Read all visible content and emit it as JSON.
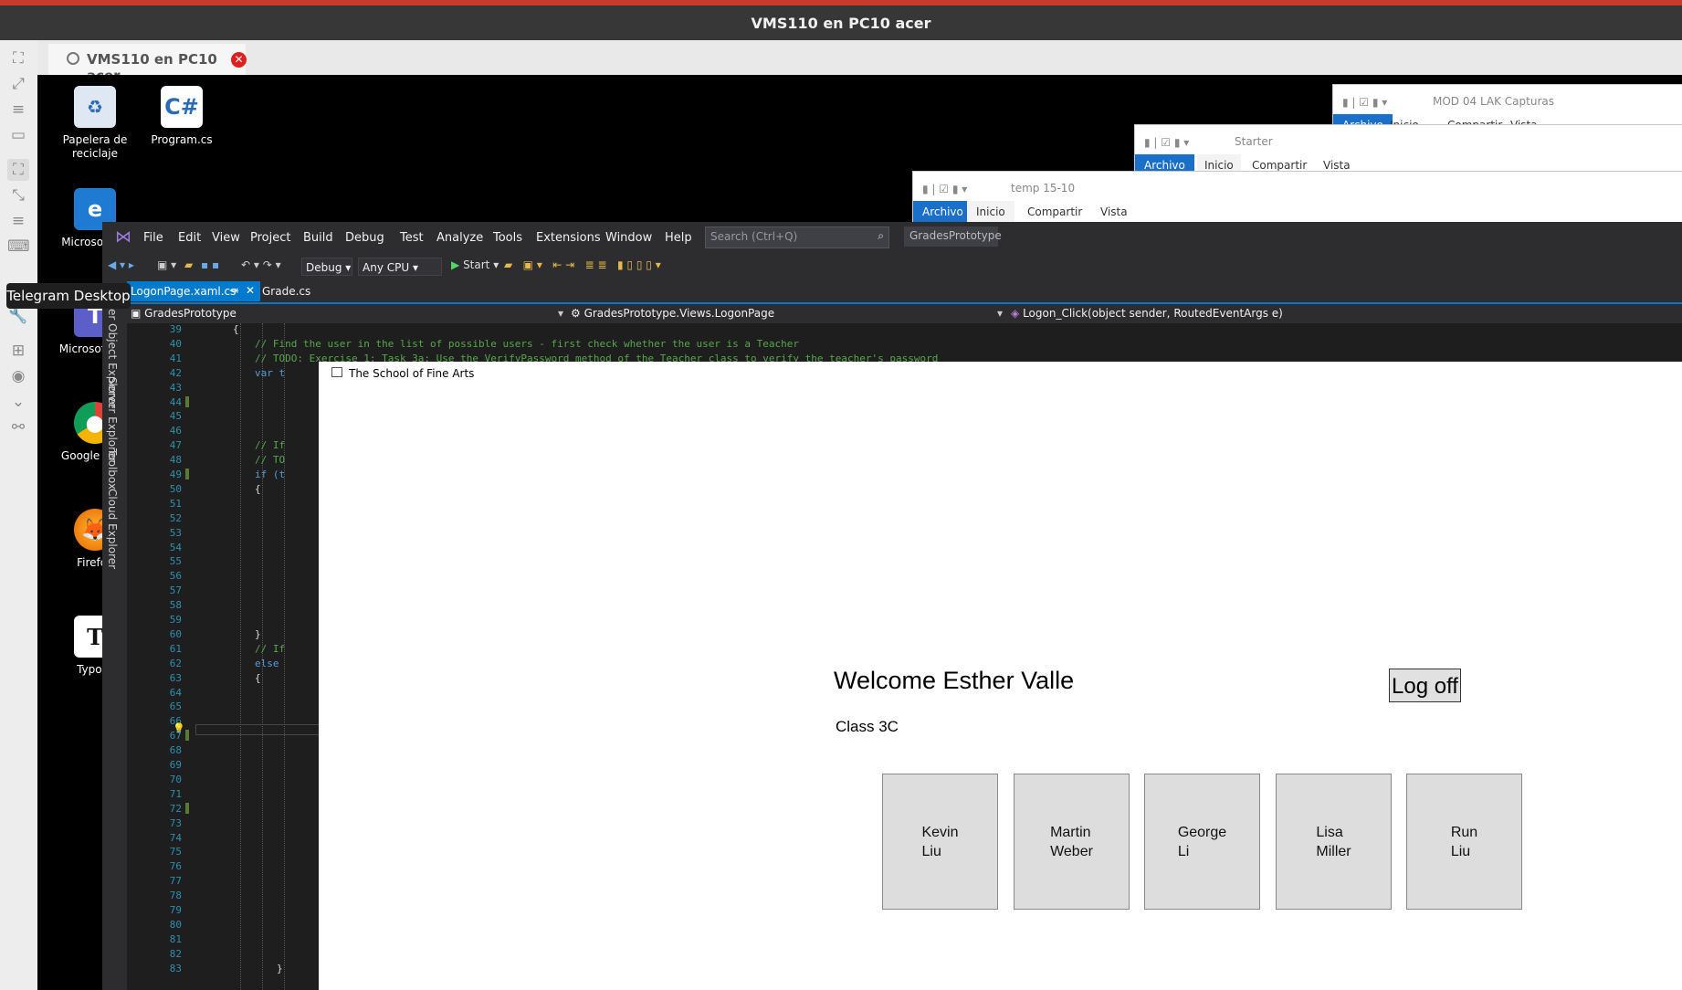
{
  "host": {
    "window_title": "VMS110 en PC10 acer",
    "tab_label": "VMS110 en PC10 acer",
    "tooltip": "Telegram Desktop"
  },
  "desktop_icons": [
    {
      "label": "Papelera de reciclaje",
      "icon": "recycle-bin-icon"
    },
    {
      "label": "Program.cs",
      "icon": "csharp-file-icon"
    },
    {
      "label": "Microsoft Ed",
      "icon": "edge-icon"
    },
    {
      "label": "Microsoft Tea",
      "icon": "teams-icon"
    },
    {
      "label": "Google Chro",
      "icon": "chrome-icon"
    },
    {
      "label": "Firefox",
      "icon": "firefox-icon"
    },
    {
      "label": "Typora",
      "icon": "typora-icon"
    }
  ],
  "explorers": [
    {
      "path": "MOD 04 LAK Capturas",
      "tabs": [
        "Archivo",
        "Inicio",
        "Compartir",
        "Vista"
      ]
    },
    {
      "path": "Starter",
      "tabs": [
        "Archivo",
        "Inicio",
        "Compartir",
        "Vista"
      ]
    },
    {
      "path": "temp 15-10",
      "tabs": [
        "Archivo",
        "Inicio",
        "Compartir",
        "Vista"
      ]
    }
  ],
  "vs": {
    "menu": [
      "File",
      "Edit",
      "View",
      "Project",
      "Build",
      "Debug",
      "Test",
      "Analyze",
      "Tools",
      "Extensions",
      "Window",
      "Help"
    ],
    "search_placeholder": "Search (Ctrl+Q)",
    "solution_name": "GradesPrototype",
    "config": "Debug",
    "platform": "Any CPU",
    "start_label": "Start",
    "side_panels": [
      "Server Object Explorer",
      "Server Explorer",
      "Toolbox",
      "Cloud Explorer"
    ],
    "doc_tabs": [
      "LogonPage.xaml.cs",
      "Grade.cs"
    ],
    "nav": {
      "project": "GradesPrototype",
      "class": "GradesPrototype.Views.LogonPage",
      "member": "Logon_Click(object sender, RoutedEventArgs e)"
    },
    "line_start": 39,
    "line_end": 83,
    "code_lines": [
      {
        "line": 39,
        "text": "{"
      },
      {
        "line": 40,
        "text": "// Find the user in the list of possible users - first check whether the user is a Teacher"
      },
      {
        "line": 41,
        "text": "// TODO: Exercise 1: Task 3a: Use the VerifyPassword method of the Teacher class to verify the teacher's password"
      },
      {
        "line": 42,
        "text": "var t"
      },
      {
        "line": 47,
        "text": "// If"
      },
      {
        "line": 48,
        "text": "// TO"
      },
      {
        "line": 49,
        "text": "if (t"
      },
      {
        "line": 50,
        "text": "{"
      },
      {
        "line": 60,
        "text": "}"
      },
      {
        "line": 61,
        "text": "// If"
      },
      {
        "line": 62,
        "text": "else"
      },
      {
        "line": 63,
        "text": "{"
      },
      {
        "line": 83,
        "text": "}"
      }
    ]
  },
  "app": {
    "title": "The School of Fine Arts",
    "welcome": "Welcome Esther Valle",
    "class_label": "Class 3C",
    "logoff_label": "Log off",
    "students": [
      {
        "first": "Kevin",
        "last": "Liu"
      },
      {
        "first": "Martin",
        "last": "Weber"
      },
      {
        "first": "George",
        "last": "Li"
      },
      {
        "first": "Lisa",
        "last": "Miller"
      },
      {
        "first": "Run",
        "last": "Liu"
      }
    ]
  }
}
